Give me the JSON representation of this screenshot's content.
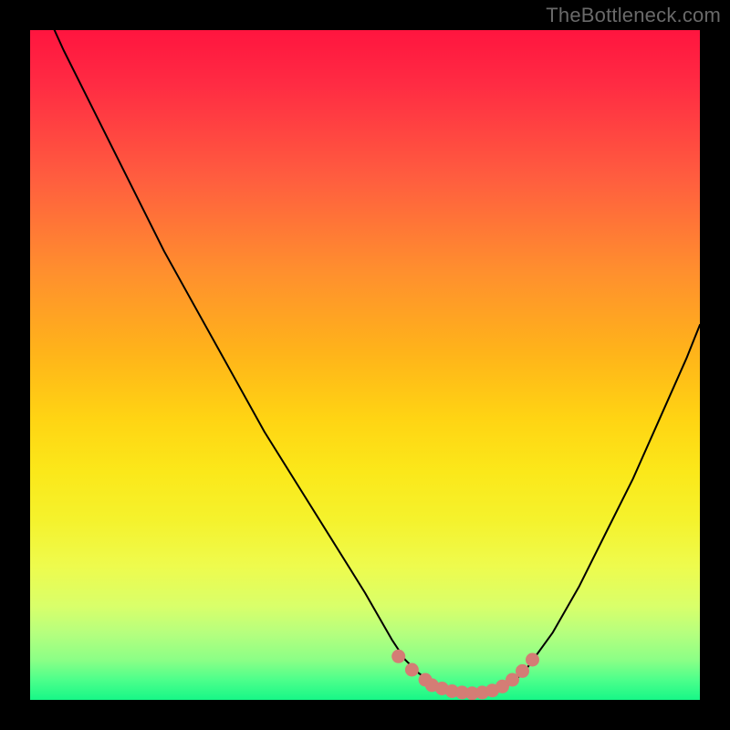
{
  "watermark": "TheBottleneck.com",
  "colors": {
    "frame": "#000000",
    "watermark_text": "#696969",
    "curve_stroke": "#000000",
    "marker_fill": "#d47d75",
    "marker_stroke": "#d47d75"
  },
  "chart_data": {
    "type": "line",
    "title": "",
    "xlabel": "",
    "ylabel": "",
    "xlim": [
      0,
      100
    ],
    "ylim": [
      0,
      100
    ],
    "series": [
      {
        "name": "bottleneck-curve",
        "x": [
          0,
          5,
          10,
          15,
          20,
          25,
          30,
          35,
          40,
          45,
          50,
          54,
          56,
          58,
          60,
          62,
          64,
          66,
          68,
          70,
          72,
          74,
          78,
          82,
          86,
          90,
          94,
          98,
          100
        ],
        "values": [
          108,
          97,
          87,
          77,
          67,
          58,
          49,
          40,
          32,
          24,
          16,
          9,
          6,
          4,
          2.5,
          1.5,
          1.0,
          1.0,
          1.0,
          1.5,
          2.5,
          4.5,
          10,
          17,
          25,
          33,
          42,
          51,
          56
        ]
      }
    ],
    "markers": {
      "name": "bottom-markers",
      "x": [
        55,
        57,
        59,
        60,
        61.5,
        63,
        64.5,
        66,
        67.5,
        69,
        70.5,
        72,
        73.5,
        75
      ],
      "values": [
        6.5,
        4.5,
        3.0,
        2.2,
        1.7,
        1.3,
        1.1,
        1.0,
        1.1,
        1.4,
        2.0,
        3.0,
        4.3,
        6.0
      ]
    }
  }
}
